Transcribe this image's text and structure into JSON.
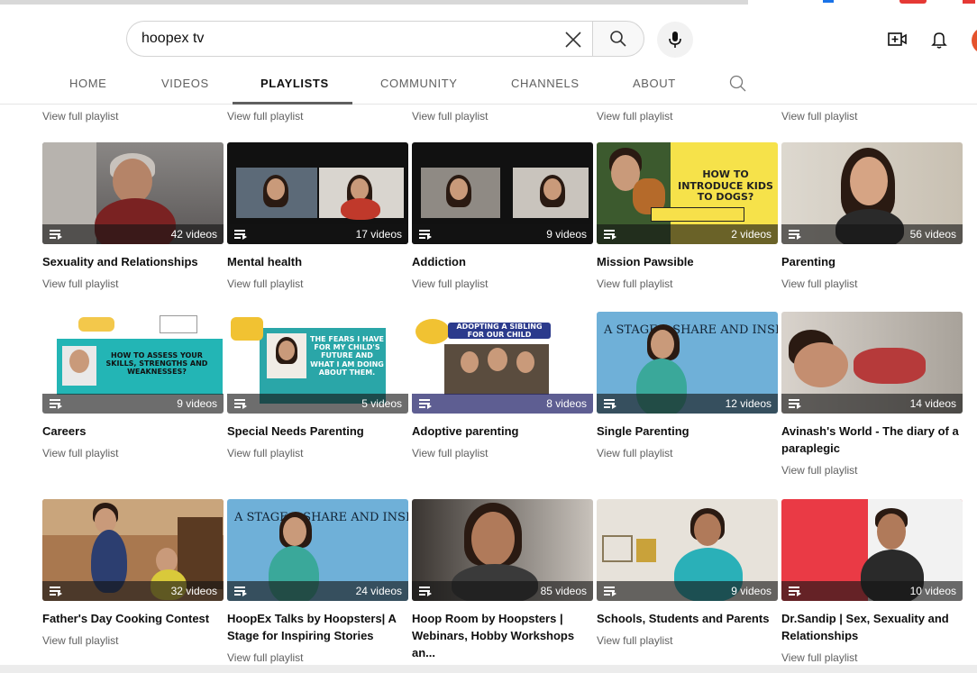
{
  "search": {
    "query": "hoopex tv"
  },
  "tabs": [
    {
      "label": "HOME"
    },
    {
      "label": "VIDEOS"
    },
    {
      "label": "PLAYLISTS"
    },
    {
      "label": "COMMUNITY"
    },
    {
      "label": "CHANNELS"
    },
    {
      "label": "ABOUT"
    }
  ],
  "view_full_playlist": "View full playlist",
  "playlists": [
    {
      "title": "Sexuality and Relationships",
      "count": "42 videos"
    },
    {
      "title": "Mental health",
      "count": "17 videos"
    },
    {
      "title": "Addiction",
      "count": "9 videos"
    },
    {
      "title": "Mission Pawsible",
      "count": "2 videos",
      "thumb_text": "HOW TO INTRODUCE KIDS TO DOGS?"
    },
    {
      "title": "Parenting",
      "count": "56 videos"
    },
    {
      "title": "Careers",
      "count": "9 videos",
      "thumb_text": "HOW TO ASSESS YOUR SKILLS, STRENGTHS AND WEAKNESSES?"
    },
    {
      "title": "Special Needs Parenting",
      "count": "5 videos",
      "thumb_text": "THE FEARS I HAVE FOR MY CHILD'S FUTURE AND WHAT I AM DOING ABOUT THEM."
    },
    {
      "title": "Adoptive parenting",
      "count": "8 videos",
      "thumb_text": "ADOPTING A SIBLING FOR OUR CHILD"
    },
    {
      "title": "Single Parenting",
      "count": "12 videos",
      "thumb_text": "A STAGE    SHARE AND INSPIR"
    },
    {
      "title": "Avinash's World - The diary of a paraplegic",
      "count": "14 videos"
    },
    {
      "title": "Father's Day Cooking Contest",
      "count": "32 videos"
    },
    {
      "title": "HoopEx Talks by Hoopsters| A Stage for Inspiring Stories",
      "count": "24 videos",
      "thumb_text": "A STAGE    SHARE AND INSPIR"
    },
    {
      "title": "Hoop Room by Hoopsters | Webinars, Hobby Workshops an...",
      "count": "85 videos"
    },
    {
      "title": "Schools, Students and Parents",
      "count": "9 videos"
    },
    {
      "title": "Dr.Sandip | Sex, Sexuality and Relationships",
      "count": "10 videos"
    }
  ],
  "colors": {
    "tab_underline": "#606060",
    "overlay": "#141414",
    "secondary_text": "#606060"
  }
}
